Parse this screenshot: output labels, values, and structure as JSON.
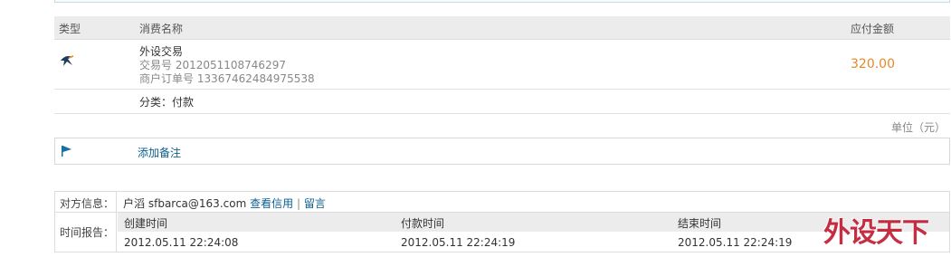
{
  "table": {
    "headers": {
      "type": "类型",
      "name": "消费名称",
      "amount": "应付金额"
    },
    "item": {
      "icon": "swallow-icon",
      "title": "外设交易",
      "trade_no": "交易号 2012051108746297",
      "merchant_no": "商户订单号 13367462484975538",
      "amount": "320.00",
      "category": "分类：付款"
    },
    "unit": "单位（元）"
  },
  "note": {
    "icon": "flag-icon",
    "label": "添加备注"
  },
  "counterparty": {
    "label": "对方信息：",
    "name": "户滔",
    "email": "sfbarca@163.com",
    "credit_link": "查看信用",
    "separator": "|",
    "message_link": "留言"
  },
  "time_report": {
    "label": "时间报告：",
    "headers": [
      "创建时间",
      "付款时间",
      "结束时间"
    ],
    "values": [
      "2012.05.11 22:24:08",
      "2012.05.11 22:24:19",
      "2012.05.11 22:24:19"
    ]
  },
  "watermark": {
    "text": "外设天下"
  },
  "colors": {
    "accent": "#e8872a",
    "link": "#0b5f8f",
    "watermark_red": "#c0192f"
  }
}
